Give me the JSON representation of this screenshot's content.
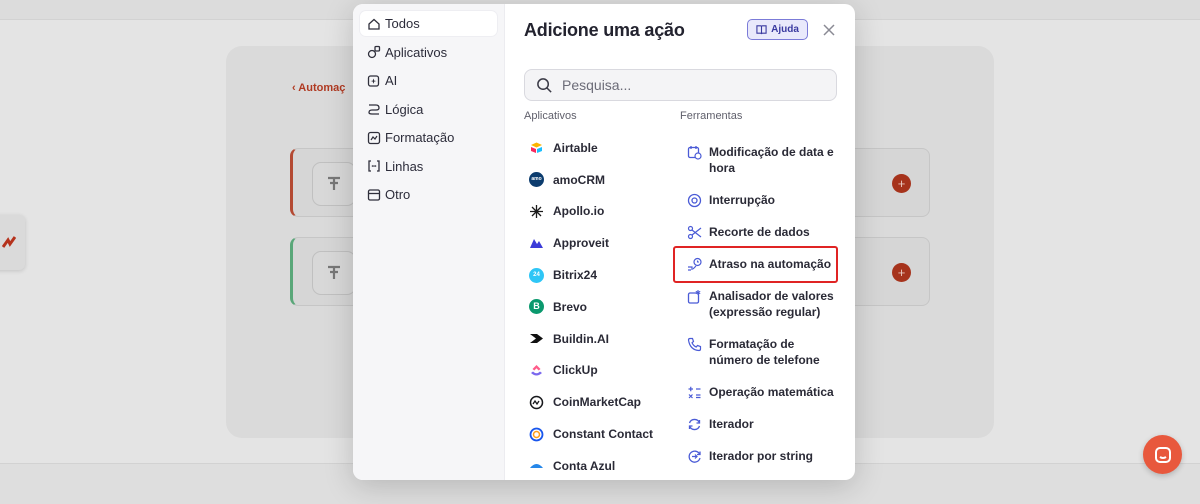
{
  "background": {
    "back_link": "‹ Automaç",
    "colors": {
      "accent_red": "#a6331c",
      "accent_green": "#5aa779",
      "fab": "#e8583d"
    }
  },
  "modal": {
    "title": "Adicione uma ação",
    "help_label": "Ajuda",
    "search": {
      "placeholder": "Pesquisa...",
      "value": ""
    },
    "categories": [
      {
        "label": "Todos",
        "icon": "home-icon",
        "active": true
      },
      {
        "label": "Aplicativos",
        "icon": "apps-icon"
      },
      {
        "label": "AI",
        "icon": "ai-sparkle-icon"
      },
      {
        "label": "Lógica",
        "icon": "logic-branch-icon"
      },
      {
        "label": "Formatação",
        "icon": "format-icon"
      },
      {
        "label": "Linhas",
        "icon": "brackets-icon"
      },
      {
        "label": "Otro",
        "icon": "archive-icon"
      }
    ],
    "apps_heading": "Aplicativos",
    "tools_heading": "Ferramentas",
    "apps": [
      {
        "label": "Airtable",
        "icon": "airtable-logo",
        "color": "#f7b500"
      },
      {
        "label": "amoCRM",
        "icon": "amocrm-logo",
        "color": "#0c3c6e"
      },
      {
        "label": "Apollo.io",
        "icon": "apollo-logo",
        "color": "#1b1b1b"
      },
      {
        "label": "Approveit",
        "icon": "approveit-logo",
        "color": "#3b3bd8"
      },
      {
        "label": "Bitrix24",
        "icon": "bitrix24-logo",
        "color": "#2fc6f6"
      },
      {
        "label": "Brevo",
        "icon": "brevo-logo",
        "color": "#0b996e"
      },
      {
        "label": "Buildin.AI",
        "icon": "buildin-logo",
        "color": "#111111"
      },
      {
        "label": "ClickUp",
        "icon": "clickup-logo",
        "color": "#7b68ee"
      },
      {
        "label": "CoinMarketCap",
        "icon": "coinmarketcap-logo",
        "color": "#17181b"
      },
      {
        "label": "Constant Contact",
        "icon": "constantcontact-logo",
        "color": "#1856ed"
      },
      {
        "label": "Conta Azul",
        "icon": "contaazul-logo",
        "color": "#2687e9"
      }
    ],
    "tools": [
      {
        "label_lines": [
          "Modificação de data e",
          "hora"
        ],
        "icon": "calendar-clock-icon"
      },
      {
        "label_lines": [
          "Interrupção"
        ],
        "icon": "stop-circle-icon"
      },
      {
        "label_lines": [
          "Recorte de dados"
        ],
        "icon": "scissors-icon"
      },
      {
        "label_lines": [
          "Atraso na automação"
        ],
        "icon": "delay-icon",
        "highlighted": true
      },
      {
        "label_lines": [
          "Analisador de valores",
          "(expressão regular)"
        ],
        "icon": "regex-icon"
      },
      {
        "label_lines": [
          "Formatação de",
          "número de telefone"
        ],
        "icon": "phone-icon"
      },
      {
        "label_lines": [
          "Operação matemática"
        ],
        "icon": "math-icon"
      },
      {
        "label_lines": [
          "Iterador"
        ],
        "icon": "iterator-icon"
      },
      {
        "label_lines": [
          "Iterador por string"
        ],
        "icon": "string-iterator-icon"
      }
    ]
  }
}
